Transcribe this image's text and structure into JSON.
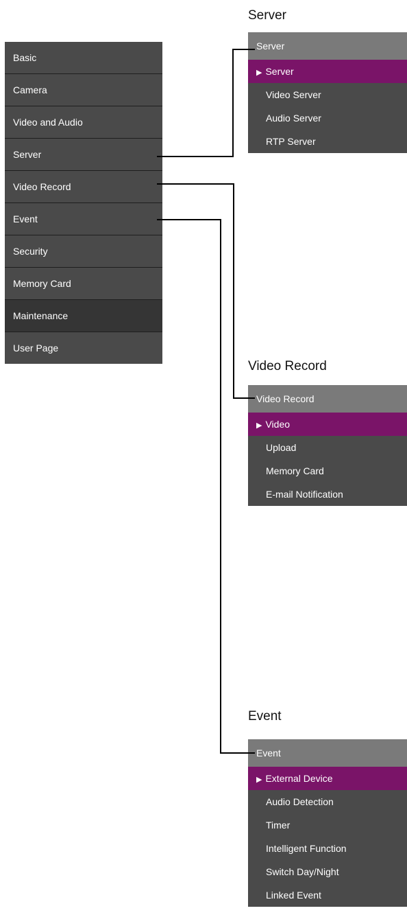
{
  "main_menu": {
    "items": [
      {
        "label": "Basic"
      },
      {
        "label": "Camera"
      },
      {
        "label": "Video and Audio"
      },
      {
        "label": "Server"
      },
      {
        "label": "Video Record"
      },
      {
        "label": "Event"
      },
      {
        "label": "Security"
      },
      {
        "label": "Memory Card"
      },
      {
        "label": "Maintenance"
      },
      {
        "label": "User Page"
      }
    ]
  },
  "submenus": {
    "server": {
      "heading": "Server",
      "title": "Server",
      "active_item": "Server",
      "items": [
        "Video Server",
        "Audio Server",
        "RTP Server"
      ]
    },
    "video_record": {
      "heading": "Video Record",
      "title": "Video Record",
      "active_item": "Video",
      "items": [
        "Upload",
        "Memory Card",
        "E-mail Notification"
      ]
    },
    "event": {
      "heading": "Event",
      "title": "Event",
      "active_item": "External Device",
      "items": [
        "Audio Detection",
        "Timer",
        "Intelligent Function",
        "Switch Day/Night",
        "Linked Event"
      ]
    }
  },
  "colors": {
    "menu_bg": "#4a4a4a",
    "menu_dark": "#353535",
    "header_bg": "#7a7a7a",
    "active_bg": "#7a1468",
    "connector": "#000000"
  },
  "icons": {
    "active_marker": "right-triangle-icon"
  }
}
